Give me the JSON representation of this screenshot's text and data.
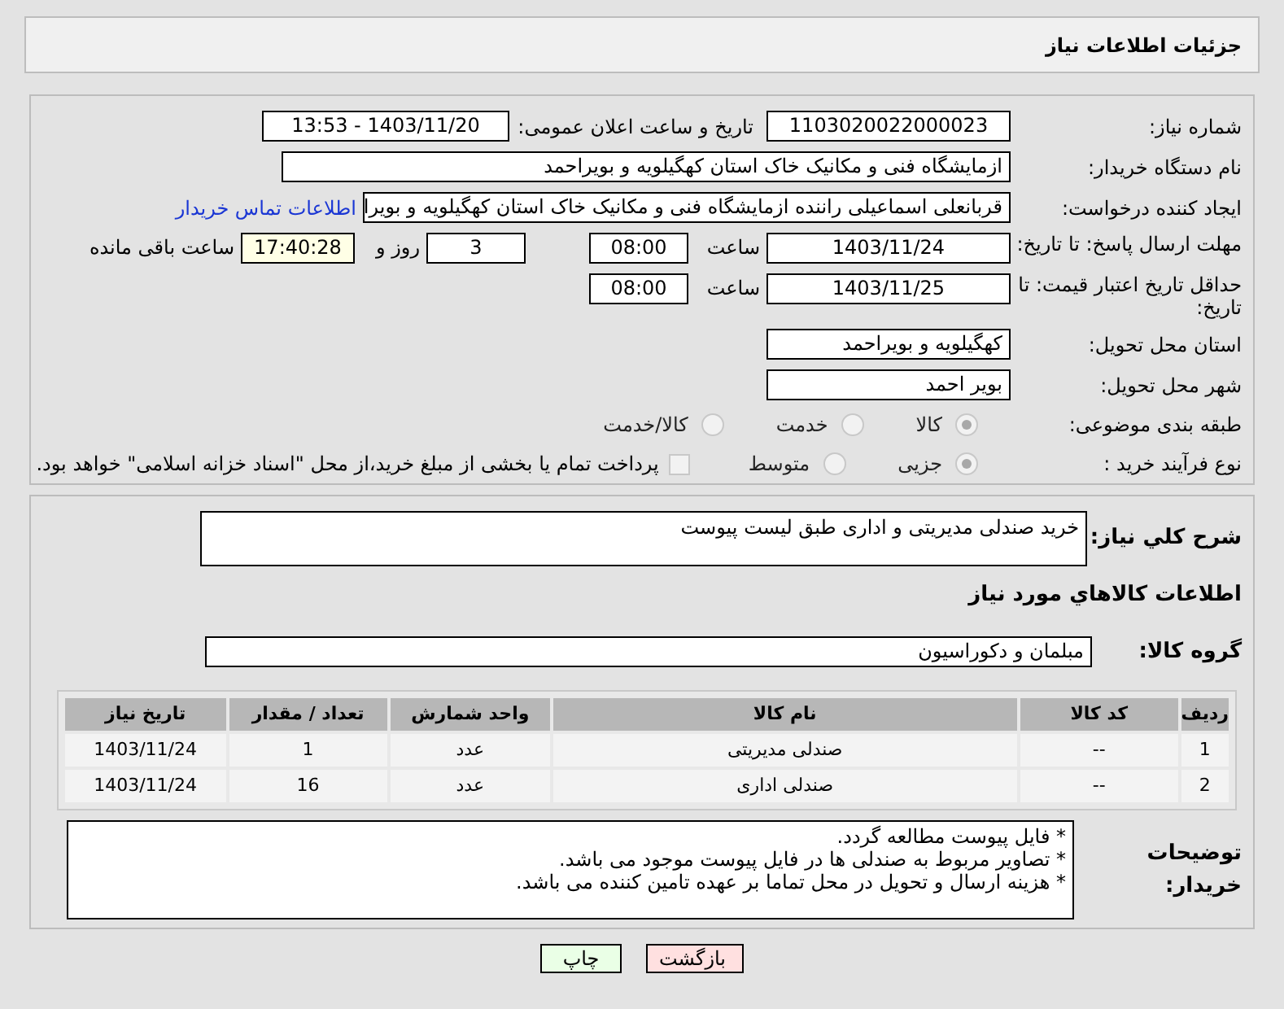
{
  "header": {
    "title": "جزئیات اطلاعات نیاز"
  },
  "need_number": {
    "label": "شماره نیاز:",
    "value": "1103020022000023"
  },
  "announce": {
    "label": "تاریخ و ساعت اعلان عمومی:",
    "value": "1403/11/20 - 13:53"
  },
  "buyer_org": {
    "label": "نام دستگاه خریدار:",
    "value": "ازمایشگاه فنی و مکانیک خاک استان کهگیلویه و بویراحمد"
  },
  "requester": {
    "label": "ایجاد کننده درخواست:",
    "value": "قربانعلی اسماعیلی راننده ازمایشگاه فنی و مکانیک خاک استان کهگیلویه و بویرا",
    "link": "اطلاعات تماس خریدار"
  },
  "deadline": {
    "label": "مهلت ارسال پاسخ: تا تاریخ:",
    "date": "1403/11/24",
    "time_label": "ساعت",
    "time": "08:00",
    "days": "3",
    "days_label": "روز و",
    "remaining": "17:40:28",
    "remaining_label": "ساعت باقی مانده"
  },
  "validity": {
    "label": "حداقل تاریخ اعتبار قیمت: تا تاریخ:",
    "date": "1403/11/25",
    "time_label": "ساعت",
    "time": "08:00"
  },
  "province": {
    "label": "استان محل تحویل:",
    "value": "کهگیلویه و بویراحمد"
  },
  "city": {
    "label": "شهر محل تحویل:",
    "value": "بویر احمد"
  },
  "category": {
    "label": "طبقه بندی موضوعی:",
    "options": [
      {
        "label": "کالا",
        "selected": true
      },
      {
        "label": "خدمت",
        "selected": false
      },
      {
        "label": "کالا/خدمت",
        "selected": false
      }
    ]
  },
  "process": {
    "label": "نوع فرآیند خرید :",
    "options": [
      {
        "label": "جزیی",
        "selected": true
      },
      {
        "label": "متوسط",
        "selected": false
      }
    ],
    "payment": {
      "checked": false,
      "label": "پرداخت تمام یا بخشی از مبلغ خرید،از محل \"اسناد خزانه اسلامی\" خواهد بود."
    }
  },
  "description": {
    "label": "شرح کلي نياز:",
    "value": "خرید صندلی مدیریتی و اداری طبق لیست پیوست"
  },
  "goods_title": "اطلاعات کالاهاي مورد نياز",
  "goods_group": {
    "label": "گروه کالا:",
    "value": "مبلمان و دکوراسیون"
  },
  "table": {
    "columns": [
      "ردیف",
      "کد کالا",
      "نام کالا",
      "واحد شمارش",
      "تعداد / مقدار",
      "تاریخ نیاز"
    ],
    "rows": [
      [
        "1",
        "--",
        "صندلی مدیریتی",
        "عدد",
        "1",
        "1403/11/24"
      ],
      [
        "2",
        "--",
        "صندلی اداری",
        "عدد",
        "16",
        "1403/11/24"
      ]
    ]
  },
  "buyer_notes": {
    "label": "توضیحات خریدار:",
    "lines": [
      "* فایل پیوست مطالعه گردد.",
      "* تصاویر مربوط به صندلی ها در فایل پیوست موجود می باشد.",
      "* هزینه ارسال و تحویل در محل تماما بر عهده تامین کننده می باشد."
    ]
  },
  "buttons": [
    {
      "label": "بازگشت",
      "kind": "back"
    },
    {
      "label": "چاپ",
      "kind": "print"
    }
  ]
}
